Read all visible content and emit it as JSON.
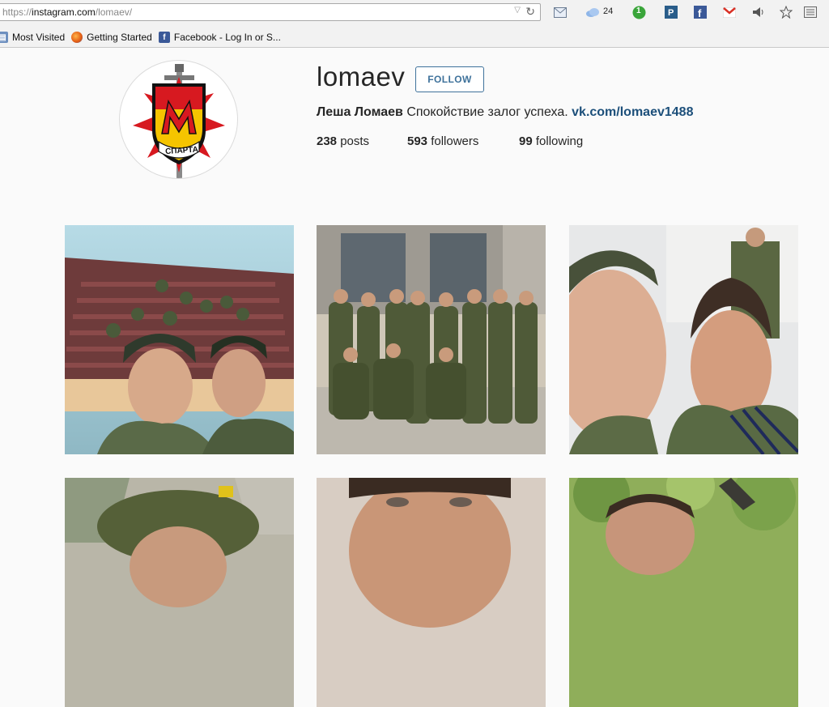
{
  "browser": {
    "url_scheme": "https://",
    "url_host": "instagram.com",
    "url_path": "/lomaev/",
    "weather_temp": "24",
    "notif_count": "1",
    "bookmarks": [
      {
        "label": "Most Visited",
        "icon": "bookmark-icon"
      },
      {
        "label": "Getting Started",
        "icon": "firefox-icon"
      },
      {
        "label": "Facebook - Log In or S...",
        "icon": "facebook-icon"
      }
    ]
  },
  "profile": {
    "username": "lomaev",
    "follow_label": "FOLLOW",
    "display_name": "Леша Ломаев",
    "bio_text": "Спокойствие залог успеха.",
    "bio_link": "vk.com/lomaev1488",
    "avatar_badge_text": "СПАРТА",
    "stats": {
      "posts_count": "238",
      "posts_label": "posts",
      "followers_count": "593",
      "followers_label": "followers",
      "following_count": "99",
      "following_label": "following"
    }
  },
  "colors": {
    "follow_blue": "#3f729b",
    "link_blue": "#1c4f7a",
    "badge_red": "#d71920",
    "badge_yellow": "#f5c400"
  },
  "photos": [
    {
      "id": 1,
      "subject": "selfie in auditorium"
    },
    {
      "id": 2,
      "subject": "group of soldiers"
    },
    {
      "id": 3,
      "subject": "close-up selfie"
    },
    {
      "id": 4,
      "subject": "helmet portrait"
    },
    {
      "id": 5,
      "subject": "face close-up"
    },
    {
      "id": 6,
      "subject": "outdoor portrait"
    }
  ]
}
